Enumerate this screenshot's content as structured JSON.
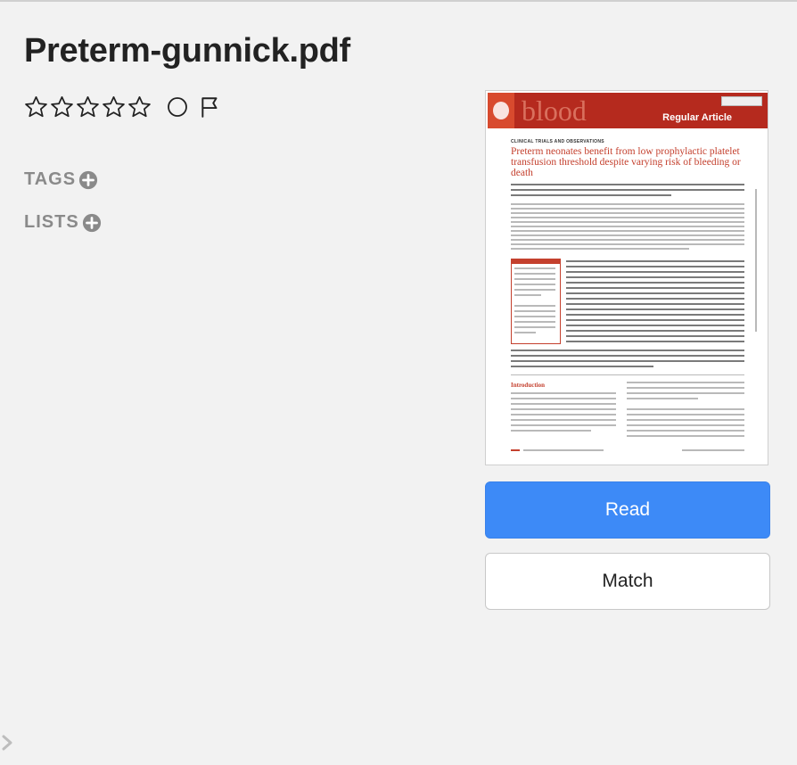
{
  "document": {
    "title": "Preterm-gunnick.pdf",
    "rating": 0,
    "max_rating": 5
  },
  "meta": {
    "tags_label": "TAGS",
    "lists_label": "LISTS"
  },
  "thumbnail": {
    "journal": "blood",
    "section": "Regular Article",
    "category": "CLINICAL TRIALS AND OBSERVATIONS",
    "article_title": "Preterm neonates benefit from low prophylactic platelet transfusion threshold despite varying risk of bleeding or death",
    "intro_heading": "Introduction"
  },
  "actions": {
    "read_label": "Read",
    "match_label": "Match"
  },
  "colors": {
    "primary": "#3d8af7",
    "background": "#f2f2f2",
    "muted_label": "#8a8a8a",
    "journal_red": "#b52a1e"
  },
  "icons": {
    "rating": "star-outline-icon",
    "status": "circle-outline-icon",
    "flag": "flag-outline-icon",
    "add": "plus-circle-icon",
    "sidebar_toggle": "chevron-right-icon"
  }
}
